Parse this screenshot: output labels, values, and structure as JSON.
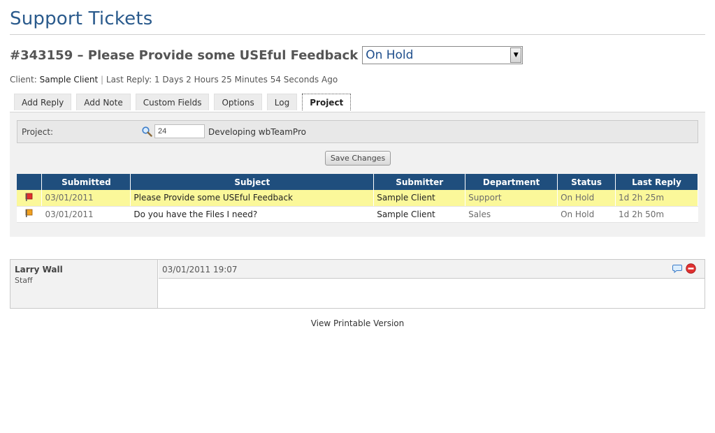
{
  "page": {
    "title": "Support Tickets"
  },
  "ticket": {
    "title": "#343159 – Please Provide some USEful Feedback",
    "status_value": "On Hold"
  },
  "client_line": {
    "label": "Client:",
    "client_name": "Sample Client",
    "separator": "|",
    "last_reply": "Last Reply: 1 Days 2 Hours 25 Minutes 54 Seconds Ago"
  },
  "tabs": [
    {
      "label": "Add Reply"
    },
    {
      "label": "Add Note"
    },
    {
      "label": "Custom Fields"
    },
    {
      "label": "Options"
    },
    {
      "label": "Log"
    },
    {
      "label": "Project"
    }
  ],
  "active_tab": "Project",
  "project": {
    "label": "Project:",
    "id_value": "24",
    "name": "Developing wbTeamPro"
  },
  "save_button": "Save Changes",
  "table": {
    "columns": [
      "",
      "Submitted",
      "Subject",
      "Submitter",
      "Department",
      "Status",
      "Last Reply"
    ],
    "rows": [
      {
        "flag_color": "#e03030",
        "submitted": "03/01/2011",
        "subject": "Please Provide some USEful Feedback",
        "submitter": "Sample Client",
        "department": "Support",
        "status": "On Hold",
        "last_reply": "1d 2h 25m",
        "highlighted": true
      },
      {
        "flag_color": "#f0a020",
        "submitted": "03/01/2011",
        "subject": "Do you have the Files I need?",
        "submitter": "Sample Client",
        "department": "Sales",
        "status": "On Hold",
        "last_reply": "1d 2h 50m",
        "highlighted": false
      }
    ]
  },
  "reply": {
    "author": "Larry Wall",
    "role": "Staff",
    "date": "03/01/2011 19:07",
    "icons": [
      "speech-bubble-icon",
      "delete-icon"
    ]
  },
  "printable_link": "View Printable Version",
  "colors": {
    "title_blue": "#2a5a8c",
    "table_header": "#1f4e7d",
    "highlight_row": "#fbf89a",
    "delete_red": "#e03030"
  }
}
